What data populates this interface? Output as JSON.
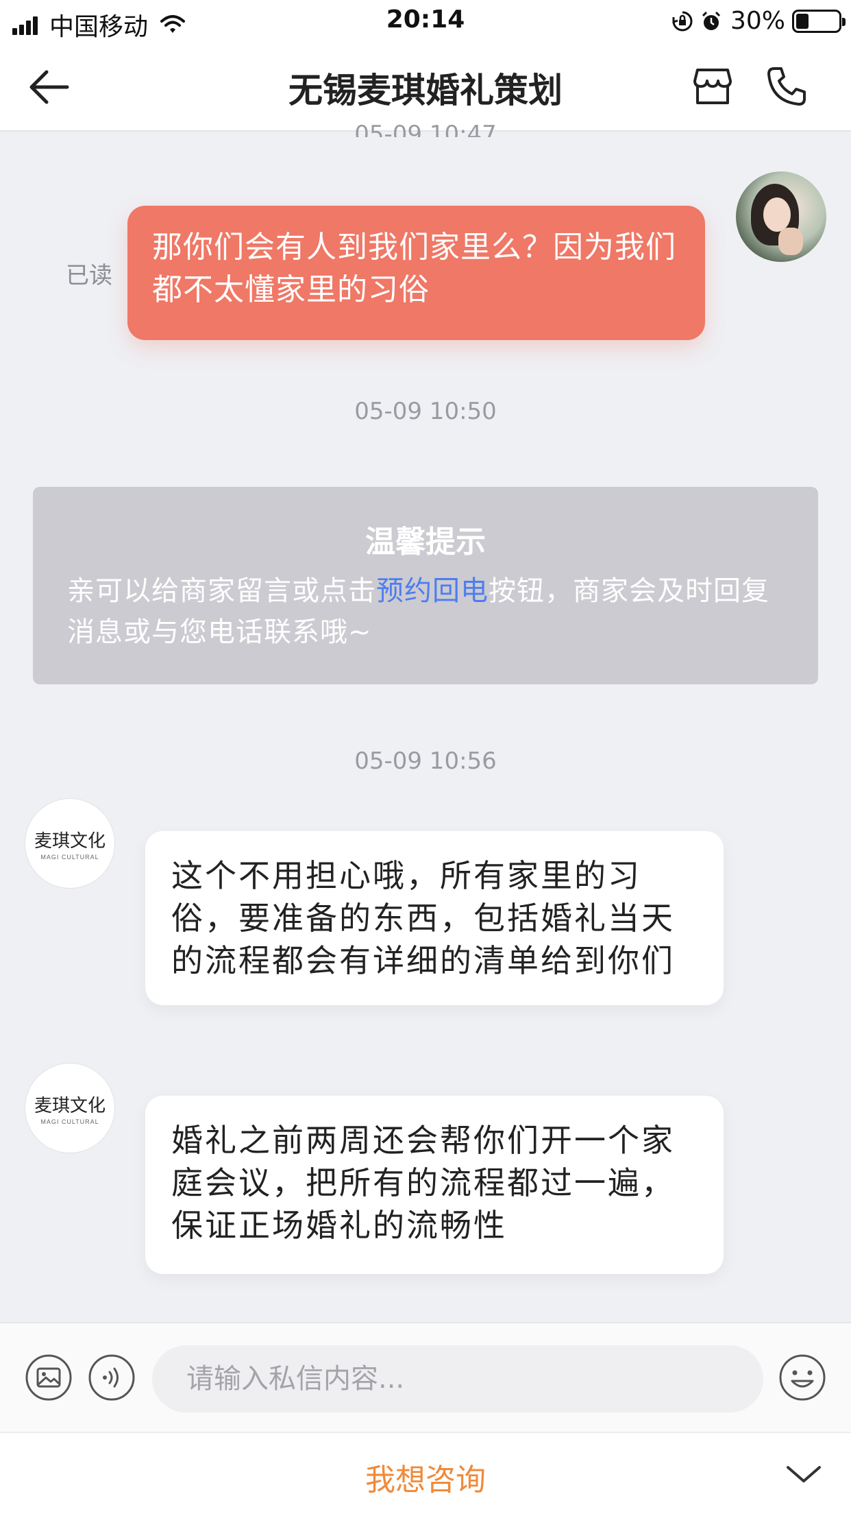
{
  "status_bar": {
    "carrier": "中国移动",
    "time": "20:14",
    "battery_percent": "30%",
    "battery_level": 0.3,
    "icons": [
      "signal-icon",
      "wifi-icon",
      "orientation-lock-icon",
      "alarm-icon",
      "battery-icon"
    ]
  },
  "nav": {
    "title": "无锡麦琪婚礼策划",
    "icons": [
      "back-arrow-icon",
      "store-icon",
      "phone-icon"
    ]
  },
  "messages": {
    "ts_top": "05-09 10:47",
    "outgoing": {
      "text": "那你们会有人到我们家里么？因为我们都不太懂家里的习俗",
      "read_label": "已读"
    },
    "ts_2": "05-09 10:50",
    "notice": {
      "title": "温馨提示",
      "body_before": "亲可以给商家留言或点击",
      "body_link": "预约回电",
      "body_after": "按钮，商家会及时回复消息或与您电话联系哦~"
    },
    "ts_3": "05-09 10:56",
    "shop_avatar": {
      "name_cn": "麦琪文化",
      "name_en": "MAGI CULTURAL"
    },
    "incoming_1": "这个不用担心哦，所有家里的习俗，要准备的东西，包括婚礼当天的流程都会有详细的清单给到你们",
    "incoming_2": "婚礼之前两周还会帮你们开一个家庭会议，把所有的流程都过一遍，保证正场婚礼的流畅性"
  },
  "input_bar": {
    "placeholder": "请输入私信内容...",
    "icons": [
      "image-icon",
      "voice-icon",
      "emoji-icon"
    ]
  },
  "bottom": {
    "consult_label": "我想咨询",
    "icon": "chevron-down-icon"
  },
  "colors": {
    "accent_orange": "#f08a3a",
    "outgoing_bubble": "#ef7866",
    "link_blue": "#4f7df0",
    "chat_bg": "#eff0f4"
  }
}
